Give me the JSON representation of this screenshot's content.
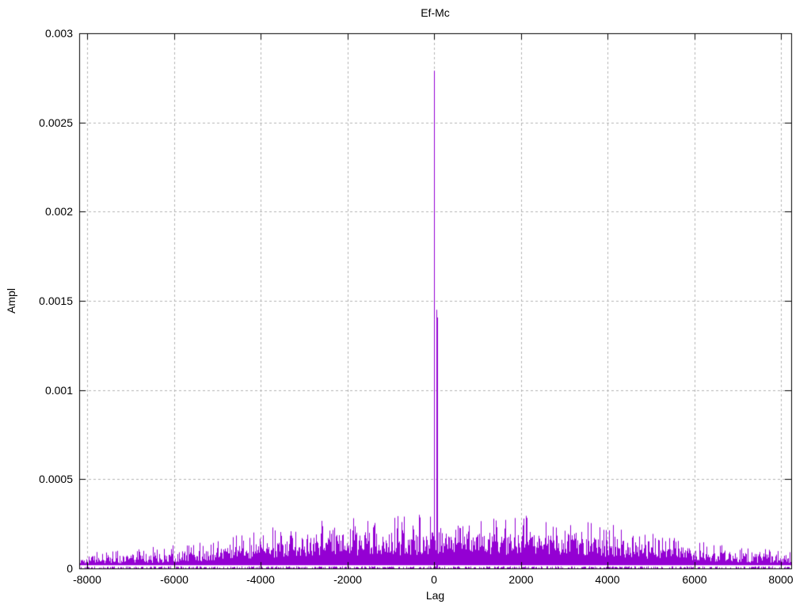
{
  "figure": {
    "title": "Ef-Mc",
    "xlabel": "Lag",
    "ylabel": "Ampl",
    "background_color": "#ffffff",
    "frame_color": "#000000",
    "grid_color": "#b4b4b4",
    "series_color": "#9400d3"
  },
  "chart_data": {
    "type": "line",
    "plot_style": "impulses",
    "title": "Ef-Mc",
    "xlabel": "Lag",
    "ylabel": "Ampl",
    "xlim": [
      -8192,
      8237
    ],
    "ylim": [
      0,
      0.003
    ],
    "grid": true,
    "legend": "none",
    "x_ticks": [
      -8000,
      -6000,
      -4000,
      -2000,
      0,
      2000,
      4000,
      6000,
      8000
    ],
    "x_tick_labels": [
      "-8000",
      "-6000",
      "-4000",
      "-2000",
      "0",
      "2000",
      "4000",
      "6000",
      "8000"
    ],
    "y_ticks": [
      0,
      0.0005,
      0.001,
      0.0015,
      0.002,
      0.0025,
      0.003
    ],
    "y_tick_labels": [
      "0",
      "0.0005",
      "0.001",
      "0.0015",
      "0.002",
      "0.0025",
      "0.003"
    ],
    "main_peak": {
      "lag": 0,
      "ampl": 0.00279
    },
    "secondary_peak": {
      "lag": 30,
      "ampl": 0.00145
    },
    "noise_envelope": {
      "description": "symmetric noise floor of cross-correlation; max = tallest impulse tips, dense = top of solid mass",
      "lags": [
        -8192,
        -7168,
        -6144,
        -5120,
        -4096,
        -3072,
        -2048,
        -1024,
        0,
        1024,
        2048,
        3072,
        4096,
        5120,
        6144,
        7168,
        8192
      ],
      "max": [
        9e-05,
        0.000105,
        0.00013,
        0.00016,
        0.00021,
        0.00027,
        0.00029,
        0.00029,
        0.00031,
        0.00029,
        0.0003,
        0.00026,
        0.00026,
        0.00019,
        0.00015,
        0.00012,
        0.0001
      ],
      "dense": [
        5e-05,
        6e-05,
        7.2e-05,
        9e-05,
        0.000115,
        0.000145,
        0.00016,
        0.000162,
        0.00017,
        0.000162,
        0.000165,
        0.00015,
        0.000142,
        0.00011,
        9e-05,
        7e-05,
        6e-05
      ]
    },
    "baseline_band": {
      "solid_floor": 1.8e-05,
      "bottom_tick_max": 1.2e-05
    },
    "noise_seed": 1337
  }
}
